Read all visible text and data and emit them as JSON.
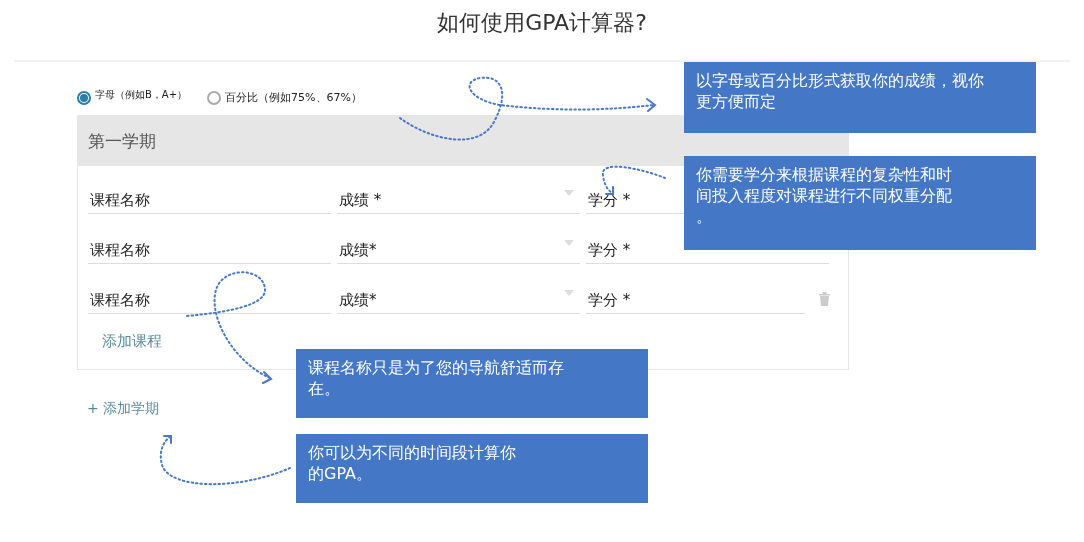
{
  "title": "如何使用GPA计算器?",
  "grade_modes": [
    {
      "label": "字母（例如B，A+）",
      "selected": true
    },
    {
      "label": "百分比（例如75%、67%）",
      "selected": false
    }
  ],
  "semester": {
    "title": "第一学期",
    "rows": [
      {
        "course": {
          "placeholder": "课程名称"
        },
        "grade": {
          "placeholder": "成绩 *"
        },
        "credits": {
          "placeholder": "学分 *"
        },
        "deletable": false
      },
      {
        "course": {
          "placeholder": "课程名称"
        },
        "grade": {
          "placeholder": "成绩*"
        },
        "credits": {
          "placeholder": "学分 *"
        },
        "deletable": false
      },
      {
        "course": {
          "placeholder": "课程名称"
        },
        "grade": {
          "placeholder": "成绩*"
        },
        "credits": {
          "placeholder": "学分 *"
        },
        "deletable": true
      }
    ],
    "add_course": "添加课程"
  },
  "add_semester": "+ 添加学期",
  "callouts": [
    {
      "lines": [
        "以字母或百分比形式获取你的成绩，视你",
        "更方便而定"
      ]
    },
    {
      "lines": [
        "你需要学分来根据课程的复杂性和时",
        "间投入程度对课程进行不同权重分配",
        "。"
      ]
    },
    {
      "lines": [
        "课程名称只是为了您的导航舒适而存",
        "在。"
      ]
    },
    {
      "lines": [
        "你可以为不同的时间段计算你",
        "的GPA。"
      ]
    }
  ]
}
